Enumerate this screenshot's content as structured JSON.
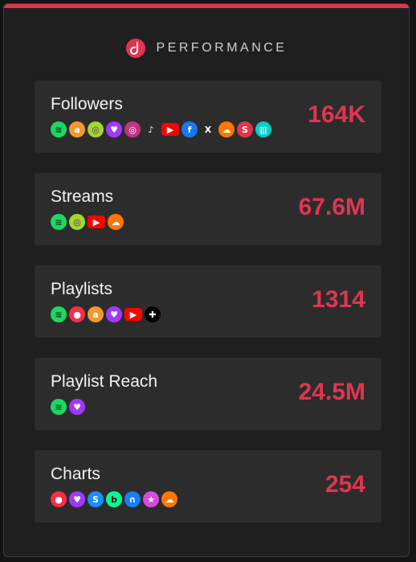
{
  "header": {
    "title": "PERFORMANCE",
    "logo_letter": "d"
  },
  "colors": {
    "accent": "#e0354f",
    "card": "#2c2c2c",
    "panel": "#1f1f1f"
  },
  "metrics": [
    {
      "label": "Followers",
      "value": "164K",
      "icons": [
        "spotify-icon",
        "amazon-music-icon",
        "anghami-icon",
        "deezer-icon",
        "instagram-icon",
        "tiktok-icon",
        "youtube-icon",
        "facebook-icon",
        "x-icon",
        "soundcloud-icon",
        "shazam-s-icon",
        "bandsintown-icon"
      ]
    },
    {
      "label": "Streams",
      "value": "67.6M",
      "icons": [
        "spotify-icon",
        "anghami-icon",
        "youtube-icon",
        "soundcloud-icon"
      ]
    },
    {
      "label": "Playlists",
      "value": "1314",
      "icons": [
        "spotify-icon",
        "apple-music-icon",
        "amazon-music-icon",
        "deezer-icon",
        "youtube-icon",
        "tidal-icon"
      ]
    },
    {
      "label": "Playlist Reach",
      "value": "24.5M",
      "icons": [
        "spotify-icon",
        "deezer-icon"
      ]
    },
    {
      "label": "Charts",
      "value": "254",
      "icons": [
        "apple-music-icon",
        "deezer-icon",
        "shazam-icon",
        "beatport-icon",
        "audiomack-icon",
        "itunes-icon",
        "soundcloud-icon"
      ]
    }
  ]
}
